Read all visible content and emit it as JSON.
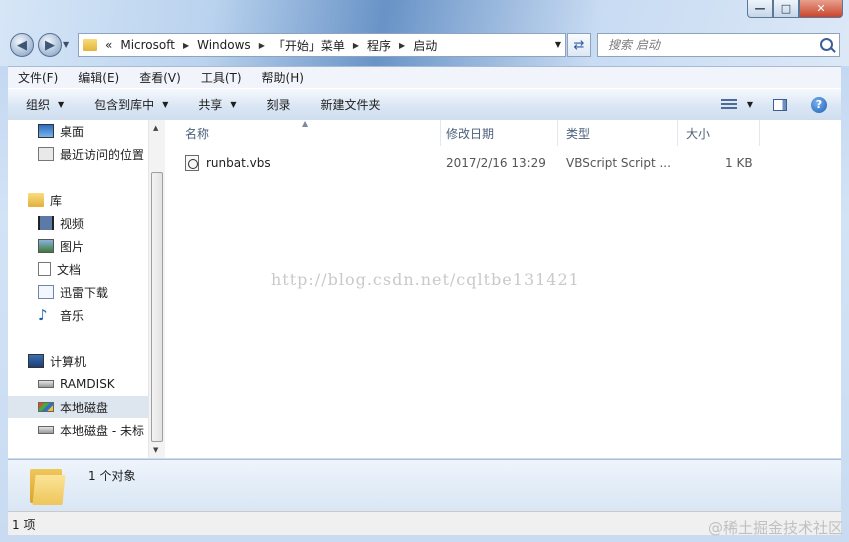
{
  "address": {
    "overflow": "«",
    "crumbs": [
      "Microsoft",
      "Windows",
      "「开始」菜单",
      "程序",
      "启动"
    ]
  },
  "search": {
    "placeholder": "搜索 启动"
  },
  "menu": [
    "文件(F)",
    "编辑(E)",
    "查看(V)",
    "工具(T)",
    "帮助(H)"
  ],
  "toolbar": {
    "organize": "组织",
    "include_library": "包含到库中",
    "share": "共享",
    "burn": "刻录",
    "new_folder": "新建文件夹"
  },
  "navigation": {
    "items": [
      {
        "label": "桌面",
        "icon": "desktop-icon"
      },
      {
        "label": "最近访问的位置",
        "icon": "recent-places-icon"
      },
      {
        "label": "库",
        "icon": "library-icon"
      },
      {
        "label": "视频",
        "icon": "video-icon"
      },
      {
        "label": "图片",
        "icon": "picture-icon"
      },
      {
        "label": "文档",
        "icon": "document-icon"
      },
      {
        "label": "迅雷下载",
        "icon": "download-icon"
      },
      {
        "label": "音乐",
        "icon": "music-icon"
      },
      {
        "label": "计算机",
        "icon": "computer-icon"
      },
      {
        "label": "RAMDISK",
        "icon": "drive-icon"
      },
      {
        "label": "本地磁盘",
        "icon": "local-disk-icon"
      },
      {
        "label": "本地磁盘 - 未标",
        "icon": "drive-icon"
      }
    ]
  },
  "columns": {
    "name": "名称",
    "modified": "修改日期",
    "type": "类型",
    "size": "大小"
  },
  "files": [
    {
      "name": "runbat.vbs",
      "modified": "2017/2/16 13:29",
      "type": "VBScript Script ...",
      "size": "1 KB"
    }
  ],
  "watermark": "http://blog.csdn.net/cqltbe131421",
  "details": {
    "count": "1 个对象"
  },
  "status": {
    "text": "1 项"
  },
  "corner_watermark": "@稀土掘金技术社区"
}
